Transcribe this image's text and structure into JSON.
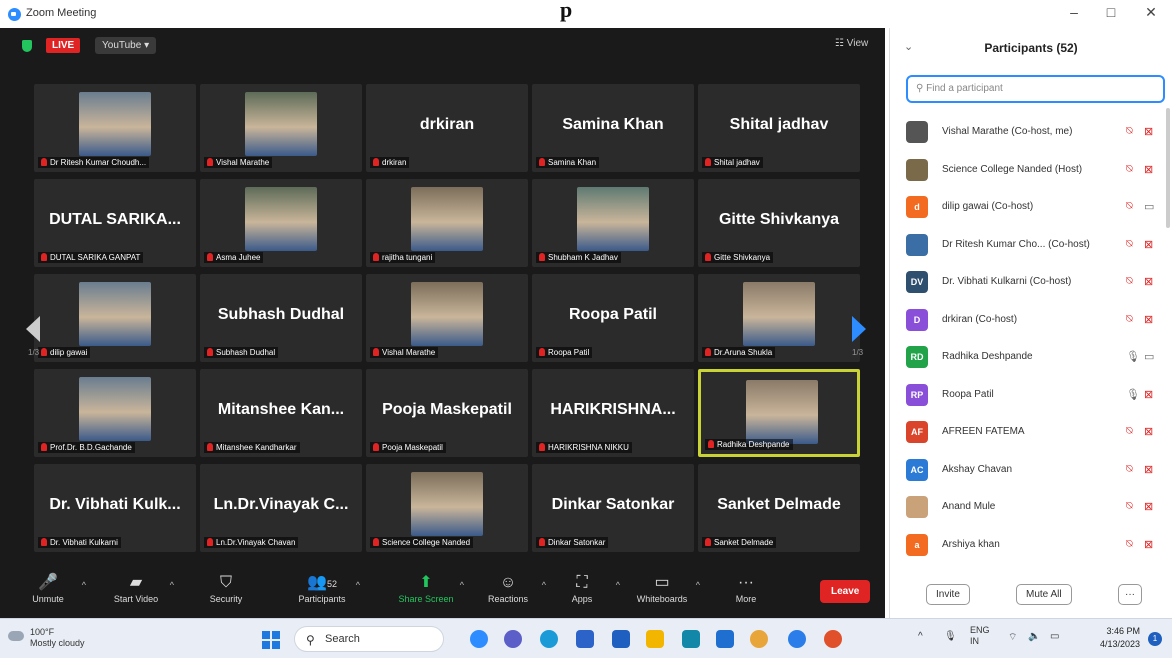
{
  "window": {
    "title": "Zoom Meeting",
    "heading_partial": "p",
    "controls": [
      "–",
      "□",
      "✕"
    ]
  },
  "topbar": {
    "live_label": "LIVE",
    "stream_label": "YouTube ▾",
    "view_label": "☷ View"
  },
  "tiles": [
    {
      "big": "",
      "label": "Dr Ritesh Kumar Choudh...",
      "photo": true
    },
    {
      "big": "",
      "label": "Vishal Marathe",
      "photo": true
    },
    {
      "big": "drkiran",
      "label": "drkiran",
      "photo": false
    },
    {
      "big": "Samina Khan",
      "label": "Samina Khan",
      "photo": false
    },
    {
      "big": "Shital jadhav",
      "label": "Shital jadhav",
      "photo": false
    },
    {
      "big": "DUTAL SARIKA...",
      "label": "DUTAL SARIKA GANPAT",
      "photo": false
    },
    {
      "big": "",
      "label": "Asma Juhee",
      "photo": true
    },
    {
      "big": "",
      "label": "rajitha tungani",
      "photo": true
    },
    {
      "big": "",
      "label": "Shubham K Jadhav",
      "photo": true
    },
    {
      "big": "Gitte Shivkanya",
      "label": "Gitte Shivkanya",
      "photo": false
    },
    {
      "big": "",
      "label": "dilip gawai",
      "photo": true
    },
    {
      "big": "Subhash Dudhal",
      "label": "Subhash Dudhal",
      "photo": false
    },
    {
      "big": "",
      "label": "Vishal Marathe",
      "photo": true
    },
    {
      "big": "Roopa Patil",
      "label": "Roopa Patil",
      "photo": false
    },
    {
      "big": "",
      "label": "Dr.Aruna Shukla",
      "photo": true
    },
    {
      "big": "",
      "label": "Prof.Dr. B.D.Gachande",
      "photo": true
    },
    {
      "big": "Mitanshee Kan...",
      "label": "Mitanshee Kandharkar",
      "photo": false
    },
    {
      "big": "Pooja Maskepatil",
      "label": "Pooja Maskepatil",
      "photo": false
    },
    {
      "big": "HARIKRISHNA...",
      "label": "HARIKRISHNA NIKKU",
      "photo": false
    },
    {
      "big": "",
      "label": "Radhika Deshpande",
      "photo": true
    },
    {
      "big": "Dr. Vibhati Kulk...",
      "label": "Dr. Vibhati Kulkarni",
      "photo": false
    },
    {
      "big": "Ln.Dr.Vinayak C...",
      "label": "Ln.Dr.Vinayak Chavan",
      "photo": false
    },
    {
      "big": "",
      "label": "Science College Nanded",
      "photo": true
    },
    {
      "big": "Dinkar Satonkar",
      "label": "Dinkar Satonkar",
      "photo": false
    },
    {
      "big": "Sanket Delmade",
      "label": "Sanket Delmade",
      "photo": false
    }
  ],
  "pager": {
    "left": "1/3",
    "right": "1/3"
  },
  "toolbar": {
    "unmute": "Unmute",
    "start_video": "Start Video",
    "security": "Security",
    "participants": "Participants",
    "participants_count": "52",
    "share_screen": "Share Screen",
    "reactions": "Reactions",
    "apps": "Apps",
    "whiteboards": "Whiteboards",
    "more": "More",
    "leave": "Leave"
  },
  "panel": {
    "title": "Participants (52)",
    "search_placeholder": "Find a participant",
    "participants": [
      {
        "name": "Vishal Marathe (Co-host, me)",
        "initials": "",
        "color": "#555555",
        "mic_muted": true,
        "cam_off": true
      },
      {
        "name": "Science College Nanded (Host)",
        "initials": "",
        "color": "#7a6a4a",
        "mic_muted": true,
        "cam_off": true
      },
      {
        "name": "dilip gawai (Co-host)",
        "initials": "d",
        "color": "#f26b21",
        "mic_muted": true,
        "cam_off": false
      },
      {
        "name": "Dr Ritesh Kumar Cho... (Co-host)",
        "initials": "",
        "color": "#3a6ea5",
        "mic_muted": true,
        "cam_off": true
      },
      {
        "name": "Dr. Vibhati Kulkarni (Co-host)",
        "initials": "DV",
        "color": "#2f4f6f",
        "mic_muted": true,
        "cam_off": true
      },
      {
        "name": "drkiran (Co-host)",
        "initials": "D",
        "color": "#8a4fd8",
        "mic_muted": true,
        "cam_off": true
      },
      {
        "name": "Radhika Deshpande",
        "initials": "RD",
        "color": "#22a34a",
        "mic_muted": false,
        "cam_off": false
      },
      {
        "name": "Roopa Patil",
        "initials": "RP",
        "color": "#8a4fd8",
        "mic_muted": false,
        "cam_off": true
      },
      {
        "name": "AFREEN FATEMA",
        "initials": "AF",
        "color": "#d9442b",
        "mic_muted": true,
        "cam_off": true
      },
      {
        "name": "Akshay Chavan",
        "initials": "AC",
        "color": "#2a7ad6",
        "mic_muted": true,
        "cam_off": true
      },
      {
        "name": "Anand Mule",
        "initials": "",
        "color": "#c9a27a",
        "mic_muted": true,
        "cam_off": true
      },
      {
        "name": "Arshiya khan",
        "initials": "a",
        "color": "#f26b21",
        "mic_muted": true,
        "cam_off": true
      }
    ],
    "invite": "Invite",
    "mute_all": "Mute All",
    "more": "···"
  },
  "taskbar": {
    "temp": "100°F",
    "weather": "Mostly cloudy",
    "search": "Search",
    "lang1": "ENG",
    "lang2": "IN",
    "time": "3:46 PM",
    "date": "4/13/2023",
    "notif_count": "1"
  }
}
